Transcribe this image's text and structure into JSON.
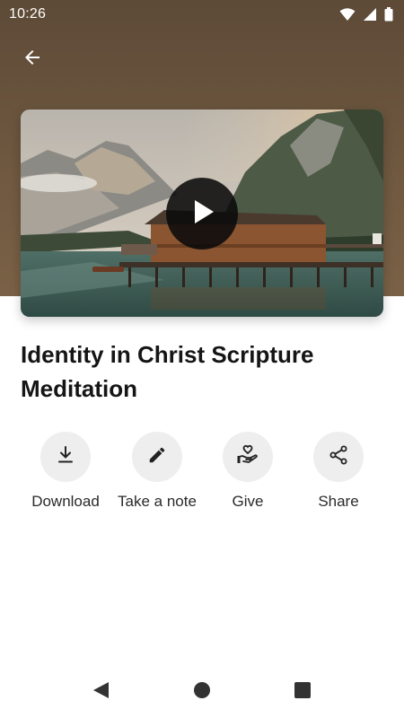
{
  "status_bar": {
    "time": "10:26",
    "icons": [
      "wifi-icon",
      "signal-icon",
      "battery-icon"
    ]
  },
  "header": {
    "back_icon": "arrow-left-icon",
    "background_color": "#6b5540"
  },
  "media": {
    "play_icon": "play-icon"
  },
  "content": {
    "title": "Identity in Christ Scripture Meditation"
  },
  "actions": [
    {
      "label": "Download",
      "icon": "download-icon"
    },
    {
      "label": "Take a note",
      "icon": "pencil-icon"
    },
    {
      "label": "Give",
      "icon": "give-heart-hand-icon"
    },
    {
      "label": "Share",
      "icon": "share-icon"
    }
  ],
  "nav": {
    "icons": [
      "back-triangle-icon",
      "home-circle-icon",
      "recents-square-icon"
    ]
  }
}
